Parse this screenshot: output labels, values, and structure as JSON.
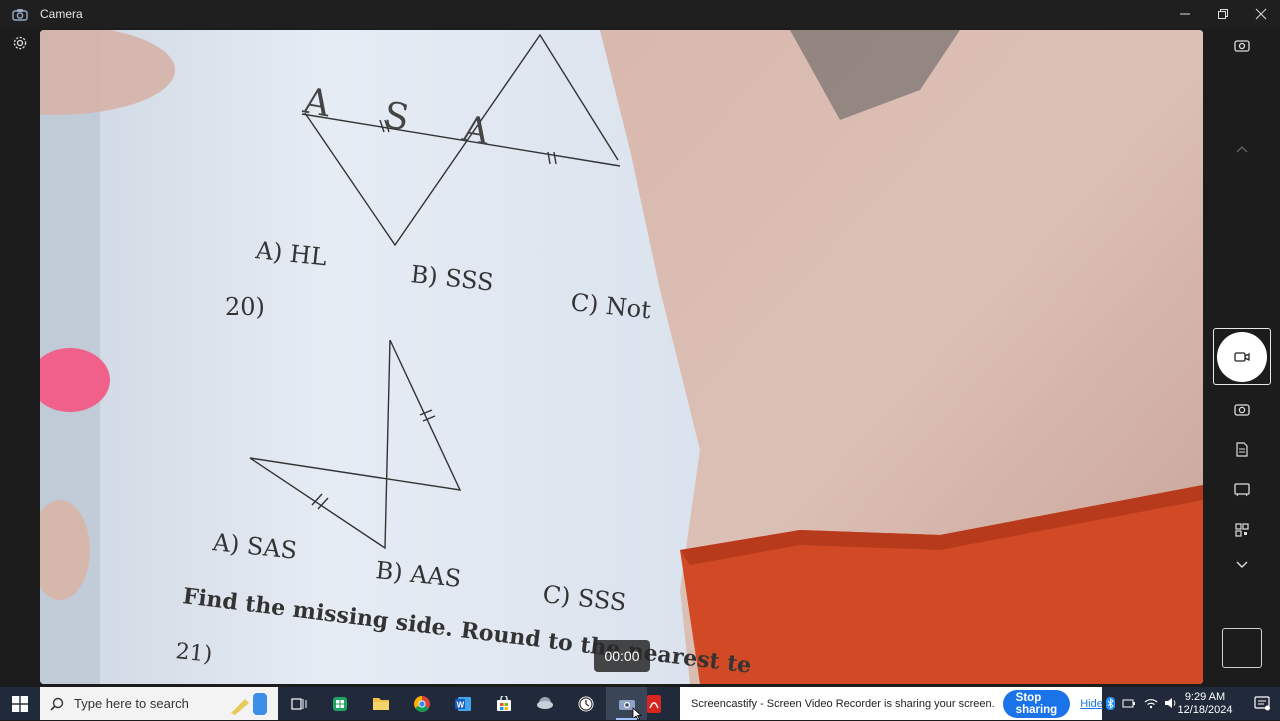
{
  "window": {
    "title": "Camera",
    "controls": [
      "minimize-icon",
      "maximize-icon",
      "close-icon"
    ]
  },
  "viewport": {
    "worksheet": {
      "problem_19_choices": [
        "A) HL",
        "B) SSS",
        "C) Not"
      ],
      "handwriting": "A S A",
      "problem_20_label": "20)",
      "problem_20_choices": [
        "A) SAS",
        "B) AAS",
        "C) SSS"
      ],
      "instruction": "Find the missing side.  Round to the nearest te",
      "problem_21_label": "21)"
    },
    "timer": "00:00"
  },
  "right_rail": {
    "buttons": [
      "switch-camera-icon",
      "collapse-up-icon",
      "video-mode-icon",
      "photo-mode-icon",
      "document-mode-icon",
      "whiteboard-mode-icon",
      "barcode-mode-icon",
      "expand-down-icon"
    ]
  },
  "taskbar": {
    "search_placeholder": "Type here to search",
    "apps": [
      "widgets-icon",
      "task-view-icon",
      "sheets-icon",
      "file-explorer-icon",
      "chrome-icon",
      "word-icon",
      "store-icon",
      "weather-app-icon",
      "clock-app-icon",
      "camera-app-icon",
      "acrobat-icon"
    ],
    "share_notice": "Screencastify - Screen Video Recorder is sharing your screen.",
    "stop_label": "Stop sharing",
    "hide_label": "Hide",
    "time": "9:29 AM",
    "date": "12/18/2024"
  },
  "colors": {
    "paper": "#dfe6f0",
    "skin": "#d7b8ad",
    "sleeve": "#d24a25",
    "eraser": "#f0608a",
    "stop_button": "#1a73e8"
  }
}
